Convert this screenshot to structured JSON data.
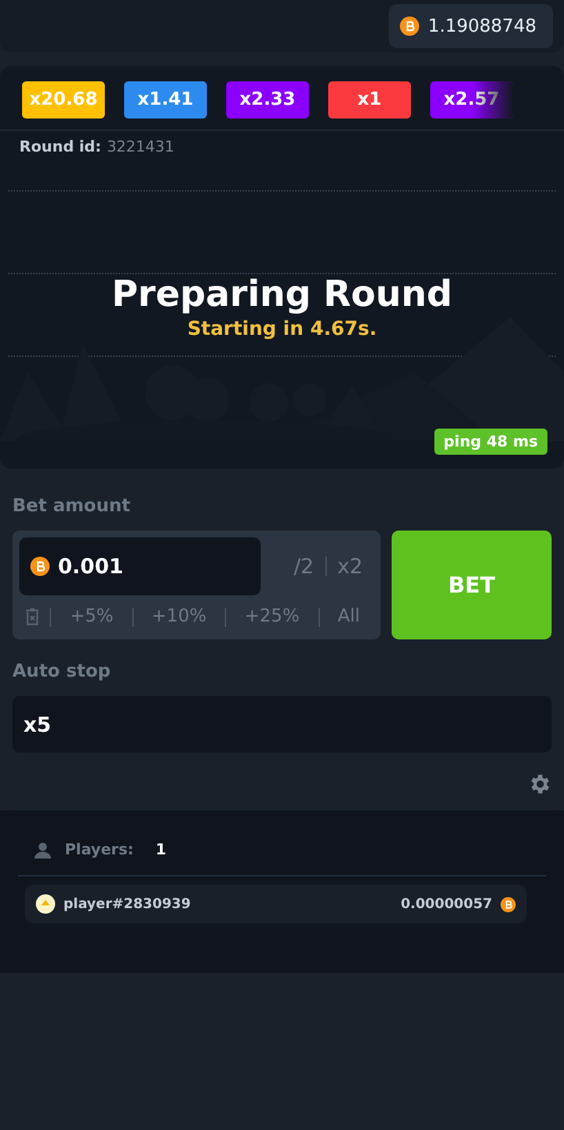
{
  "balance": "1.19088748",
  "history": [
    {
      "label": "x20.68",
      "color": "#ffc000"
    },
    {
      "label": "x1.41",
      "color": "#2d8bf0"
    },
    {
      "label": "x2.33",
      "color": "#8c00ff"
    },
    {
      "label": "x1",
      "color": "#fa3a3e"
    },
    {
      "label": "x2.57",
      "color": "#8c00ff"
    }
  ],
  "round": {
    "label": "Round id:",
    "value": "3221431"
  },
  "status": {
    "title": "Preparing Round",
    "subtitle": "Starting in 4.67s."
  },
  "ping": "ping 48 ms",
  "bet": {
    "label": "Bet amount",
    "value": "0.001",
    "half": "/2",
    "double": "x2",
    "quick": [
      "+5%",
      "+10%",
      "+25%",
      "All"
    ],
    "button": "BET"
  },
  "auto_stop": {
    "label": "Auto stop",
    "value": "x5"
  },
  "players": {
    "label": "Players:",
    "count": "1",
    "rows": [
      {
        "name": "player#2830939",
        "amount": "0.00000057"
      }
    ]
  }
}
